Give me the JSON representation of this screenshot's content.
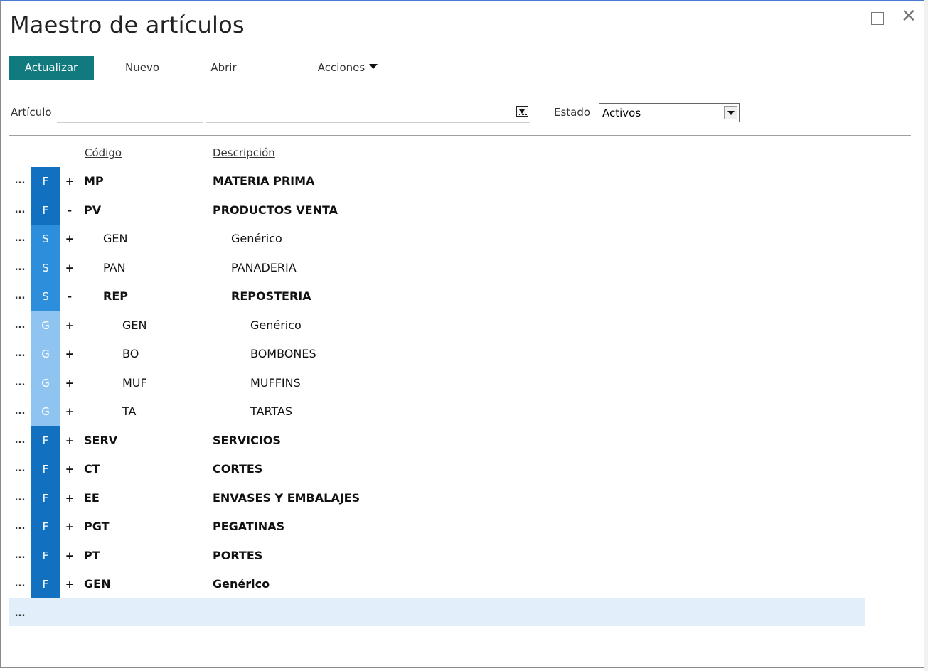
{
  "window": {
    "title": "Maestro de artículos",
    "maximize_icon": "maximize-icon",
    "close_icon": "close-icon"
  },
  "toolbar": {
    "refresh_label": "Actualizar",
    "new_label": "Nuevo",
    "open_label": "Abrir",
    "actions_label": "Acciones"
  },
  "filters": {
    "article_label": "Artículo",
    "article_code_value": "",
    "article_desc_value": "",
    "state_label": "Estado",
    "state_value": "Activos"
  },
  "grid": {
    "columns": {
      "code": "Código",
      "description": "Descripción"
    },
    "row_menu": "...",
    "level_colors": {
      "F": "#1170c0",
      "S": "#2d8fdc",
      "G": "#8ec4ef"
    },
    "rows": [
      {
        "level": "F",
        "depth": 0,
        "expander": "+",
        "code": "MP",
        "description": "MATERIA PRIMA",
        "bold": true
      },
      {
        "level": "F",
        "depth": 0,
        "expander": "-",
        "code": "PV",
        "description": "PRODUCTOS VENTA",
        "bold": true
      },
      {
        "level": "S",
        "depth": 1,
        "expander": "+",
        "code": "GEN",
        "description": "Genérico",
        "bold": false
      },
      {
        "level": "S",
        "depth": 1,
        "expander": "+",
        "code": "PAN",
        "description": "PANADERIA",
        "bold": false
      },
      {
        "level": "S",
        "depth": 1,
        "expander": "-",
        "code": "REP",
        "description": "REPOSTERIA",
        "bold": true
      },
      {
        "level": "G",
        "depth": 2,
        "expander": "+",
        "code": "GEN",
        "description": "Genérico",
        "bold": false
      },
      {
        "level": "G",
        "depth": 2,
        "expander": "+",
        "code": "BO",
        "description": "BOMBONES",
        "bold": false
      },
      {
        "level": "G",
        "depth": 2,
        "expander": "+",
        "code": "MUF",
        "description": "MUFFINS",
        "bold": false
      },
      {
        "level": "G",
        "depth": 2,
        "expander": "+",
        "code": "TA",
        "description": "TARTAS",
        "bold": false
      },
      {
        "level": "F",
        "depth": 0,
        "expander": "+",
        "code": "SERV",
        "description": "SERVICIOS",
        "bold": true
      },
      {
        "level": "F",
        "depth": 0,
        "expander": "+",
        "code": "CT",
        "description": "CORTES",
        "bold": true
      },
      {
        "level": "F",
        "depth": 0,
        "expander": "+",
        "code": "EE",
        "description": "ENVASES Y EMBALAJES",
        "bold": true
      },
      {
        "level": "F",
        "depth": 0,
        "expander": "+",
        "code": "PGT",
        "description": "PEGATINAS",
        "bold": true
      },
      {
        "level": "F",
        "depth": 0,
        "expander": "+",
        "code": "PT",
        "description": "PORTES",
        "bold": true
      },
      {
        "level": "F",
        "depth": 0,
        "expander": "+",
        "code": "GEN",
        "description": "Genérico",
        "bold": true
      }
    ]
  }
}
